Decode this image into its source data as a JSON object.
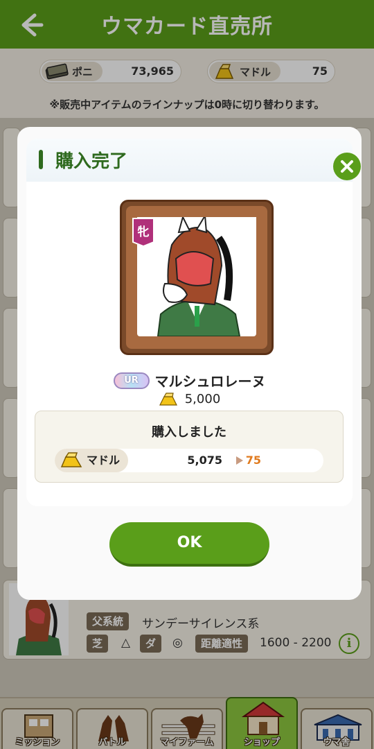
{
  "header": {
    "title": "ウマカード直売所"
  },
  "currencies": [
    {
      "label": "ポニ",
      "value": "73,965"
    },
    {
      "label": "マドル",
      "value": "75"
    }
  ],
  "notice": "※販売中アイテムのラインナップは0時に切り替わります。",
  "bottom_card": {
    "sire_tag": "父系統",
    "sire_value": "サンデーサイレンス系",
    "turf_tag": "芝",
    "turf_mark": "△",
    "dirt_tag": "ダ",
    "dirt_mark": "◎",
    "distance_tag": "距離適性",
    "distance_value": "1600 - 2200"
  },
  "modal": {
    "title": "購入完了",
    "gender": "牝",
    "rarity": "UR",
    "horse_name": "マルシュロレーヌ",
    "price": "5,000",
    "bought_label": "購入しました",
    "currency_label": "マドル",
    "from_value": "5,075",
    "to_value": "75",
    "ok_label": "OK"
  },
  "nav": [
    {
      "label": "ミッション"
    },
    {
      "label": "バトル"
    },
    {
      "label": "マイファーム"
    },
    {
      "label": "ショップ",
      "active": true
    },
    {
      "label": "ウマ舎"
    }
  ],
  "colors": {
    "accent": "#5a9e1a",
    "title_green": "#2e6a1e",
    "orange": "#e07a1e"
  }
}
